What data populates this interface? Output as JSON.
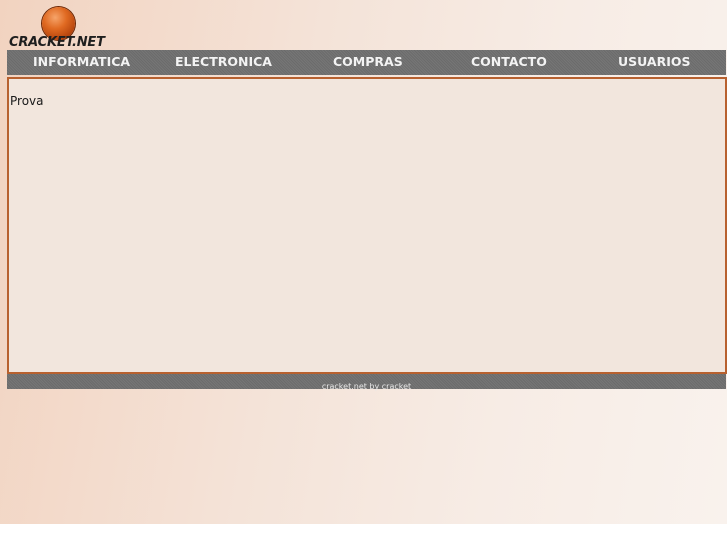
{
  "logo": {
    "text": "CRACKET.NET"
  },
  "nav": {
    "items": [
      {
        "label": "INFORMATICA"
      },
      {
        "label": "ELECTRONICA"
      },
      {
        "label": "COMPRAS"
      },
      {
        "label": "CONTACTO"
      },
      {
        "label": "USUARIOS"
      }
    ]
  },
  "content": {
    "text": "Prova"
  },
  "footer": {
    "text": "cracket.net by cracket"
  },
  "colors": {
    "nav_bar": "#6f6f6f",
    "content_border": "#b8612f",
    "content_bg": "#f2e6dd",
    "logo_ball": "#e06a22"
  },
  "icons": {
    "logo": "orange-ball-icon"
  }
}
